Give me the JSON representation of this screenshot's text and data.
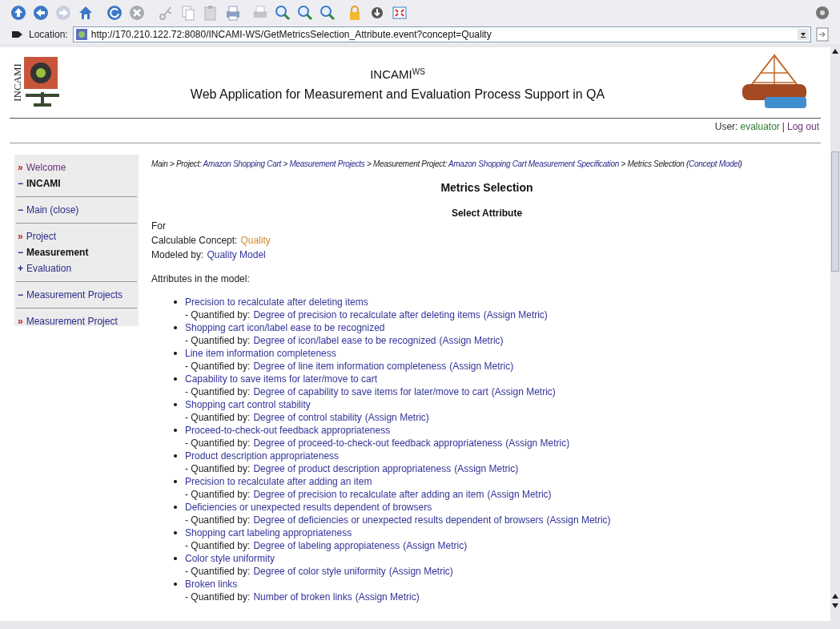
{
  "location_bar": {
    "label": "Location:",
    "url": "http://170.210.122.72:8080/INCAMI-WS/GetMetricsSelection_Attribute.event?concept=Quality"
  },
  "header": {
    "logo_text": "INCAMI",
    "title": "INCAMI",
    "title_sup": "WS",
    "subtitle": "Web Application for Measurement and Evaluation Process Support in QA",
    "user_label": "User:",
    "user": "evaluator",
    "separator": "|",
    "logout": "Log out"
  },
  "sidebar": {
    "groups": [
      [
        {
          "marker": "»",
          "kind": "chevron",
          "label": "Welcome",
          "bold": false
        },
        {
          "marker": "−",
          "kind": "dash",
          "label": "INCAMI",
          "bold": true
        }
      ],
      [
        {
          "marker": "−",
          "kind": "dash",
          "label": "Main (close)",
          "bold": false
        }
      ],
      [
        {
          "marker": "»",
          "kind": "chevron",
          "label": "Project",
          "bold": false
        },
        {
          "marker": "−",
          "kind": "dash",
          "label": "Measurement",
          "bold": true
        },
        {
          "marker": "+",
          "kind": "plus",
          "label": "Evaluation",
          "bold": false
        }
      ],
      [
        {
          "marker": "−",
          "kind": "dash",
          "label": "Measurement Projects",
          "bold": false
        }
      ],
      [
        {
          "marker": "»",
          "kind": "chevron",
          "label": "Measurement Project",
          "bold": false
        }
      ]
    ]
  },
  "breadcrumb": [
    {
      "text": "Main > Project: ",
      "kind": "plain"
    },
    {
      "text": "Amazon Shopping Cart",
      "kind": "link"
    },
    {
      "text": " > ",
      "kind": "plain"
    },
    {
      "text": "Measurement Projects",
      "kind": "link"
    },
    {
      "text": " > Measurement Project: ",
      "kind": "plain"
    },
    {
      "text": "Amazon Shopping Cart Measurement Specification",
      "kind": "link"
    },
    {
      "text": " > Metrics Selection (",
      "kind": "plain"
    },
    {
      "text": "Concept Model",
      "kind": "link"
    },
    {
      "text": ")",
      "kind": "plain"
    }
  ],
  "page_title": "Metrics Selection",
  "section_title": "Select Attribute",
  "for_label": "For",
  "concept": {
    "label": "Calculable Concept:",
    "value": "Quality"
  },
  "model": {
    "label": "Modeled by:",
    "value": "Quality Model"
  },
  "attributes_label": "Attributes in the model:",
  "attributes": [
    {
      "name": "Precision to recalculate after deleting items",
      "quantified_label": "- Quantified by:",
      "metric": "Degree of precision to recalculate after deleting items",
      "action": "(Assign Metric)"
    },
    {
      "name": "Shopping cart icon/label ease to be recognized",
      "quantified_label": "- Quantified by:",
      "metric": "Degree of icon/label ease to be recognized",
      "action": "(Assign Metric)"
    },
    {
      "name": "Line item information completeness",
      "quantified_label": "- Quantified by:",
      "metric": "Degree of line item information completeness",
      "action": "(Assign Metric)"
    },
    {
      "name": "Capability to save items for later/move to cart",
      "quantified_label": "- Quantified by:",
      "metric": "Degree of capability to save items for later/move to cart",
      "action": "(Assign Metric)"
    },
    {
      "name": "Shopping cart control stability",
      "quantified_label": "- Quantified by:",
      "metric": "Degree of control stability",
      "action": "(Assign Metric)"
    },
    {
      "name": "Proceed-to-check-out feedback appropriateness",
      "quantified_label": "- Quantified by:",
      "metric": "Degree of proceed-to-check-out feedback appropriateness",
      "action": "(Assign Metric)"
    },
    {
      "name": "Product description appropriateness",
      "quantified_label": "- Quantified by:",
      "metric": "Degree of product description appropriateness",
      "action": "(Assign Metric)"
    },
    {
      "name": "Precision to recalculate after adding an item",
      "quantified_label": "- Quantified by:",
      "metric": "Degree of precision to recalculate after adding an item",
      "action": "(Assign Metric)"
    },
    {
      "name": "Deficiencies or unexpected results dependent of browsers",
      "quantified_label": "- Quantified by:",
      "metric": "Degree of deficiencies or unexpected results dependent of browsers",
      "action": "(Assign Metric)"
    },
    {
      "name": "Shopping cart labeling appropriateness",
      "quantified_label": "- Quantified by:",
      "metric": "Degree of labeling appropiateness",
      "action": "(Assign Metric)"
    },
    {
      "name": "Color style uniformity",
      "quantified_label": "- Quantified by:",
      "metric": "Degree of color style uniformity",
      "action": "(Assign Metric)"
    },
    {
      "name": "Broken links",
      "quantified_label": "- Quantified by:",
      "metric": "Number of broken links",
      "action": "(Assign Metric)"
    }
  ]
}
